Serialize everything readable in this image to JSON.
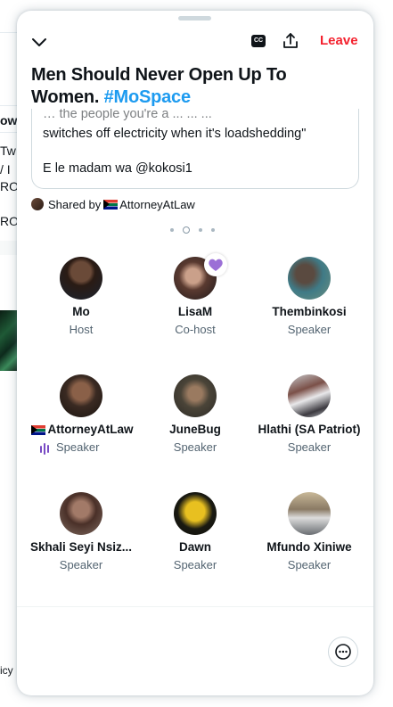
{
  "background": {
    "lines": [
      "ow",
      "Tw",
      "/ I",
      "RO",
      "RO",
      "icy"
    ]
  },
  "space": {
    "cc_label": "CC",
    "leave_label": "Leave",
    "title": "Men Should Never Open Up To Women.",
    "hashtag": "#MoSpace"
  },
  "shared_tweet": {
    "cut_line": "… the people you're a ... ... ...",
    "line1": "switches off electricity when it's loadshedding\"",
    "line2": "E le madam wa @kokosi1",
    "shared_prefix": "Shared by",
    "shared_by": "AttorneyAtLaw"
  },
  "speakers": [
    {
      "name": "Mo",
      "role": "Host"
    },
    {
      "name": "LisaM",
      "role": "Co-host"
    },
    {
      "name": "Thembinkosi",
      "role": "Speaker"
    },
    {
      "name": "AttorneyAtLaw",
      "role": "Speaker"
    },
    {
      "name": "JuneBug",
      "role": "Speaker"
    },
    {
      "name": "Hlathi (SA Patriot)",
      "role": "Speaker"
    },
    {
      "name": "Skhali Seyi Nsiz...",
      "role": "Speaker"
    },
    {
      "name": "Dawn",
      "role": "Speaker"
    },
    {
      "name": "Mfundo Xiniwe",
      "role": "Speaker"
    }
  ],
  "colors": {
    "leave": "#f4212e",
    "hashtag": "#1d9bf0",
    "reaction": "#9b6fd6",
    "speaking": "#794bc4"
  },
  "icons": {
    "collapse": "chevron-down-icon",
    "captions": "closed-captions-icon",
    "share": "share-icon",
    "reaction": "purple-heart-icon",
    "speaking": "audio-bars-icon",
    "chat": "more-options-icon"
  }
}
